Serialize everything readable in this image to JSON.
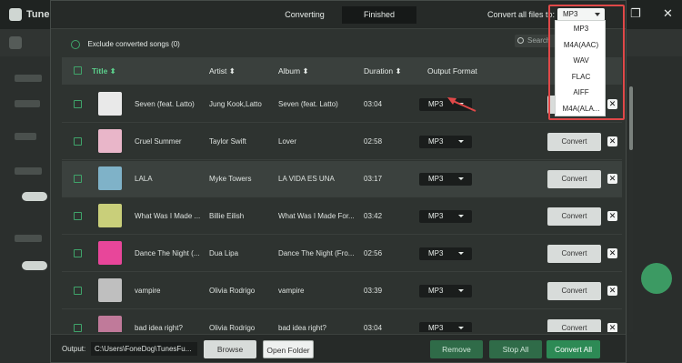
{
  "app": {
    "title": "Tunes",
    "window_buttons": [
      "—",
      "❐",
      "✕"
    ]
  },
  "tabs": {
    "converting": "Converting",
    "finished": "Finished"
  },
  "convert_all": {
    "label": "Convert all files to:",
    "selected": "MP3"
  },
  "dropdown_options": [
    "MP3",
    "M4A(AAC)",
    "WAV",
    "FLAC",
    "AIFF",
    "M4A(ALA..."
  ],
  "exclude": {
    "label": "Exclude converted songs (0)"
  },
  "search": {
    "placeholder": "Search"
  },
  "columns": {
    "title": "Title ⬍",
    "artist": "Artist ⬍",
    "album": "Album ⬍",
    "duration": "Duration ⬍",
    "output_format": "Output Format"
  },
  "rows": [
    {
      "title": "Seven (feat. Latto)",
      "artist": "Jung Kook,Latto",
      "album": "Seven (feat. Latto)",
      "duration": "03:04",
      "format": "MP3",
      "action": "Convert",
      "thumb_color": "#e9e9e9",
      "highlight": false
    },
    {
      "title": "Cruel Summer",
      "artist": "Taylor Swift",
      "album": "Lover",
      "duration": "02:58",
      "format": "MP3",
      "action": "Convert",
      "thumb_color": "#e9b6c9",
      "highlight": false
    },
    {
      "title": "LALA",
      "artist": "Myke Towers",
      "album": "LA VIDA ES UNA",
      "duration": "03:17",
      "format": "MP3",
      "action": "Convert",
      "thumb_color": "#7fb2c8",
      "highlight": true
    },
    {
      "title": "What Was I Made ...",
      "artist": "Billie Eilish",
      "album": "What Was I Made For...",
      "duration": "03:42",
      "format": "MP3",
      "action": "Convert",
      "thumb_color": "#c9cf7a",
      "highlight": false
    },
    {
      "title": "Dance The Night (...",
      "artist": "Dua Lipa",
      "album": "Dance The Night (Fro...",
      "duration": "02:56",
      "format": "MP3",
      "action": "Convert",
      "thumb_color": "#e8469a",
      "highlight": false
    },
    {
      "title": "vampire",
      "artist": "Olivia Rodrigo",
      "album": "vampire",
      "duration": "03:39",
      "format": "MP3",
      "action": "Convert",
      "thumb_color": "#bfbfbf",
      "highlight": false
    },
    {
      "title": "bad idea right?",
      "artist": "Olivia Rodrigo",
      "album": "bad idea right?",
      "duration": "03:04",
      "format": "MP3",
      "action": "Convert",
      "thumb_color": "#c07a9a",
      "highlight": false
    }
  ],
  "footer": {
    "output_label": "Output:",
    "output_path": "C:\\Users\\FoneDog\\TunesFu...",
    "browse": "Browse",
    "open_folder": "Open Folder",
    "remove": "Remove",
    "stop_all": "Stop All",
    "convert_all": "Convert All"
  },
  "colors": {
    "accent": "#3fa46a",
    "highlight_border": "#e04848"
  }
}
